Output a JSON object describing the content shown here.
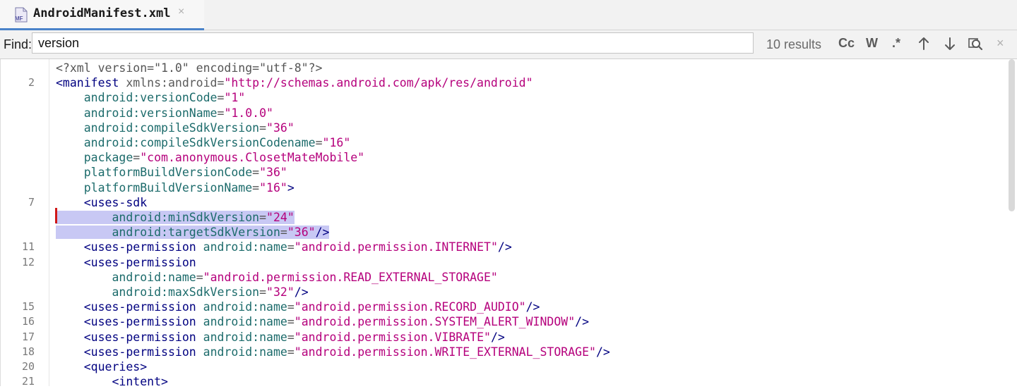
{
  "tab": {
    "filename": "AndroidManifest.xml",
    "icon_text": "MF",
    "close": "×"
  },
  "find": {
    "label": "Find:",
    "query": "version",
    "results": "10 results",
    "match_case": "Cc",
    "words": "W",
    "regex": ".*",
    "close": "×"
  },
  "lines": [
    {
      "num": "",
      "segs": [
        {
          "t": "<?xml version=\"1.0\" encoding=\"utf-8\"?>",
          "c": "pi"
        }
      ]
    },
    {
      "num": "2",
      "segs": [
        {
          "t": "<manifest ",
          "c": "tag"
        },
        {
          "t": "xmlns:android",
          "c": "ns"
        },
        {
          "t": "=",
          "c": "pi"
        },
        {
          "t": "\"http://schemas.android.com/apk/res/android\"",
          "c": "val"
        }
      ]
    },
    {
      "num": "",
      "segs": [
        {
          "t": "    "
        },
        {
          "t": "android:versionCode",
          "c": "attr"
        },
        {
          "t": "=",
          "c": "pi"
        },
        {
          "t": "\"1\"",
          "c": "val"
        }
      ]
    },
    {
      "num": "",
      "segs": [
        {
          "t": "    "
        },
        {
          "t": "android:versionName",
          "c": "attr"
        },
        {
          "t": "=",
          "c": "pi"
        },
        {
          "t": "\"1.0.0\"",
          "c": "val"
        }
      ]
    },
    {
      "num": "",
      "segs": [
        {
          "t": "    "
        },
        {
          "t": "android:compileSdkVersion",
          "c": "attr"
        },
        {
          "t": "=",
          "c": "pi"
        },
        {
          "t": "\"36\"",
          "c": "val"
        }
      ]
    },
    {
      "num": "",
      "segs": [
        {
          "t": "    "
        },
        {
          "t": "android:compileSdkVersionCodename",
          "c": "attr"
        },
        {
          "t": "=",
          "c": "pi"
        },
        {
          "t": "\"16\"",
          "c": "val"
        }
      ]
    },
    {
      "num": "",
      "segs": [
        {
          "t": "    "
        },
        {
          "t": "package",
          "c": "attr"
        },
        {
          "t": "=",
          "c": "pi"
        },
        {
          "t": "\"com.anonymous.ClosetMateMobile\"",
          "c": "val"
        }
      ]
    },
    {
      "num": "",
      "segs": [
        {
          "t": "    "
        },
        {
          "t": "platformBuildVersionCode",
          "c": "attr"
        },
        {
          "t": "=",
          "c": "pi"
        },
        {
          "t": "\"36\"",
          "c": "val"
        }
      ]
    },
    {
      "num": "",
      "segs": [
        {
          "t": "    "
        },
        {
          "t": "platformBuildVersionName",
          "c": "attr"
        },
        {
          "t": "=",
          "c": "pi"
        },
        {
          "t": "\"16\"",
          "c": "val"
        },
        {
          "t": ">",
          "c": "tag"
        }
      ]
    },
    {
      "num": "7",
      "segs": [
        {
          "t": "    "
        },
        {
          "t": "<uses-sdk",
          "c": "tag"
        }
      ]
    },
    {
      "num": "",
      "sel": true,
      "segs": [
        {
          "t": "        "
        },
        {
          "t": "android:minSdkVersion",
          "c": "attr"
        },
        {
          "t": "=",
          "c": "pi"
        },
        {
          "t": "\"24\"",
          "c": "val"
        }
      ]
    },
    {
      "num": "",
      "sel": true,
      "segs": [
        {
          "t": "        "
        },
        {
          "t": "android:targetSdkVersion",
          "c": "attr"
        },
        {
          "t": "=",
          "c": "pi"
        },
        {
          "t": "\"36\"",
          "c": "val"
        },
        {
          "t": "/>",
          "c": "tag"
        }
      ]
    },
    {
      "num": "11",
      "segs": [
        {
          "t": "    "
        },
        {
          "t": "<uses-permission ",
          "c": "tag"
        },
        {
          "t": "android:name",
          "c": "attr"
        },
        {
          "t": "=",
          "c": "pi"
        },
        {
          "t": "\"android.permission.INTERNET\"",
          "c": "val"
        },
        {
          "t": "/>",
          "c": "tag"
        }
      ]
    },
    {
      "num": "12",
      "segs": [
        {
          "t": "    "
        },
        {
          "t": "<uses-permission",
          "c": "tag"
        }
      ]
    },
    {
      "num": "",
      "segs": [
        {
          "t": "        "
        },
        {
          "t": "android:name",
          "c": "attr"
        },
        {
          "t": "=",
          "c": "pi"
        },
        {
          "t": "\"android.permission.READ_EXTERNAL_STORAGE\"",
          "c": "val"
        }
      ]
    },
    {
      "num": "",
      "segs": [
        {
          "t": "        "
        },
        {
          "t": "android:maxSdkVersion",
          "c": "attr"
        },
        {
          "t": "=",
          "c": "pi"
        },
        {
          "t": "\"32\"",
          "c": "val"
        },
        {
          "t": "/>",
          "c": "tag"
        }
      ]
    },
    {
      "num": "15",
      "segs": [
        {
          "t": "    "
        },
        {
          "t": "<uses-permission ",
          "c": "tag"
        },
        {
          "t": "android:name",
          "c": "attr"
        },
        {
          "t": "=",
          "c": "pi"
        },
        {
          "t": "\"android.permission.RECORD_AUDIO\"",
          "c": "val"
        },
        {
          "t": "/>",
          "c": "tag"
        }
      ]
    },
    {
      "num": "16",
      "segs": [
        {
          "t": "    "
        },
        {
          "t": "<uses-permission ",
          "c": "tag"
        },
        {
          "t": "android:name",
          "c": "attr"
        },
        {
          "t": "=",
          "c": "pi"
        },
        {
          "t": "\"android.permission.SYSTEM_ALERT_WINDOW\"",
          "c": "val"
        },
        {
          "t": "/>",
          "c": "tag"
        }
      ]
    },
    {
      "num": "17",
      "segs": [
        {
          "t": "    "
        },
        {
          "t": "<uses-permission ",
          "c": "tag"
        },
        {
          "t": "android:name",
          "c": "attr"
        },
        {
          "t": "=",
          "c": "pi"
        },
        {
          "t": "\"android.permission.VIBRATE\"",
          "c": "val"
        },
        {
          "t": "/>",
          "c": "tag"
        }
      ]
    },
    {
      "num": "18",
      "segs": [
        {
          "t": "    "
        },
        {
          "t": "<uses-permission ",
          "c": "tag"
        },
        {
          "t": "android:name",
          "c": "attr"
        },
        {
          "t": "=",
          "c": "pi"
        },
        {
          "t": "\"android.permission.WRITE_EXTERNAL_STORAGE\"",
          "c": "val"
        },
        {
          "t": "/>",
          "c": "tag"
        }
      ]
    },
    {
      "num": "20",
      "segs": [
        {
          "t": "    "
        },
        {
          "t": "<queries>",
          "c": "tag"
        }
      ]
    },
    {
      "num": "21",
      "segs": [
        {
          "t": "        "
        },
        {
          "t": "<intent>",
          "c": "tag"
        }
      ]
    }
  ]
}
